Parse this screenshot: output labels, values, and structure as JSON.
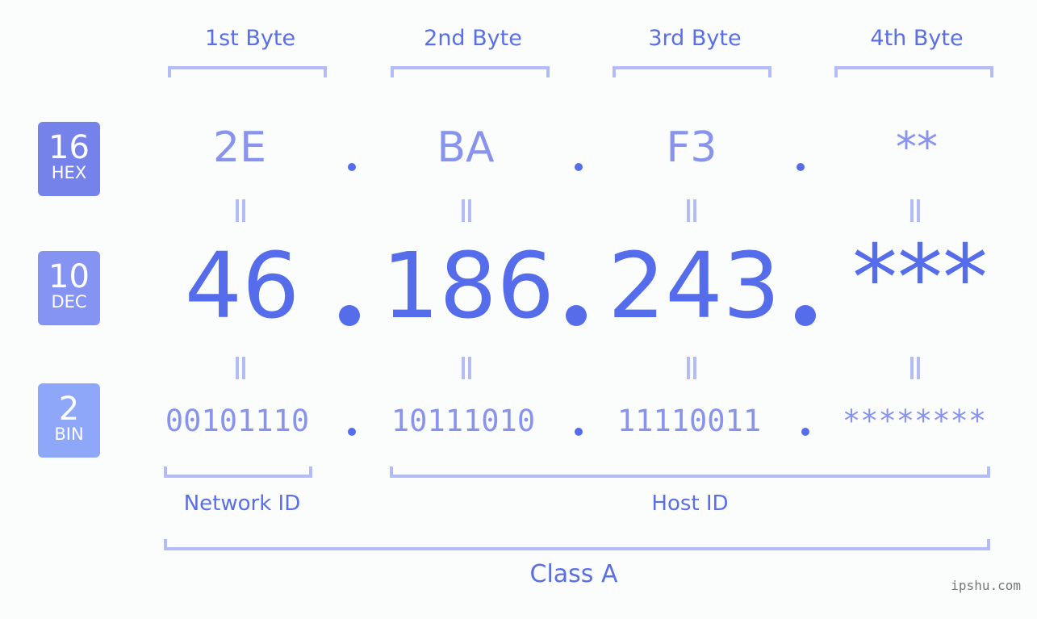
{
  "bytes": [
    {
      "label": "1st Byte",
      "hex": "2E",
      "dec": "46",
      "bin": "00101110"
    },
    {
      "label": "2nd Byte",
      "hex": "BA",
      "dec": "186",
      "bin": "10111010"
    },
    {
      "label": "3rd Byte",
      "hex": "F3",
      "dec": "243",
      "bin": "11110011"
    },
    {
      "label": "4th Byte",
      "hex": "**",
      "dec": "***",
      "bin": "********"
    }
  ],
  "bases": [
    {
      "num": "16",
      "label": "HEX",
      "color": "#7482ea"
    },
    {
      "num": "10",
      "label": "DEC",
      "color": "#8593f2"
    },
    {
      "num": "2",
      "label": "BIN",
      "color": "#8ea7f8"
    }
  ],
  "segments": {
    "network": "Network ID",
    "host": "Host ID",
    "class": "Class A"
  },
  "watermark": "ipshu.com"
}
